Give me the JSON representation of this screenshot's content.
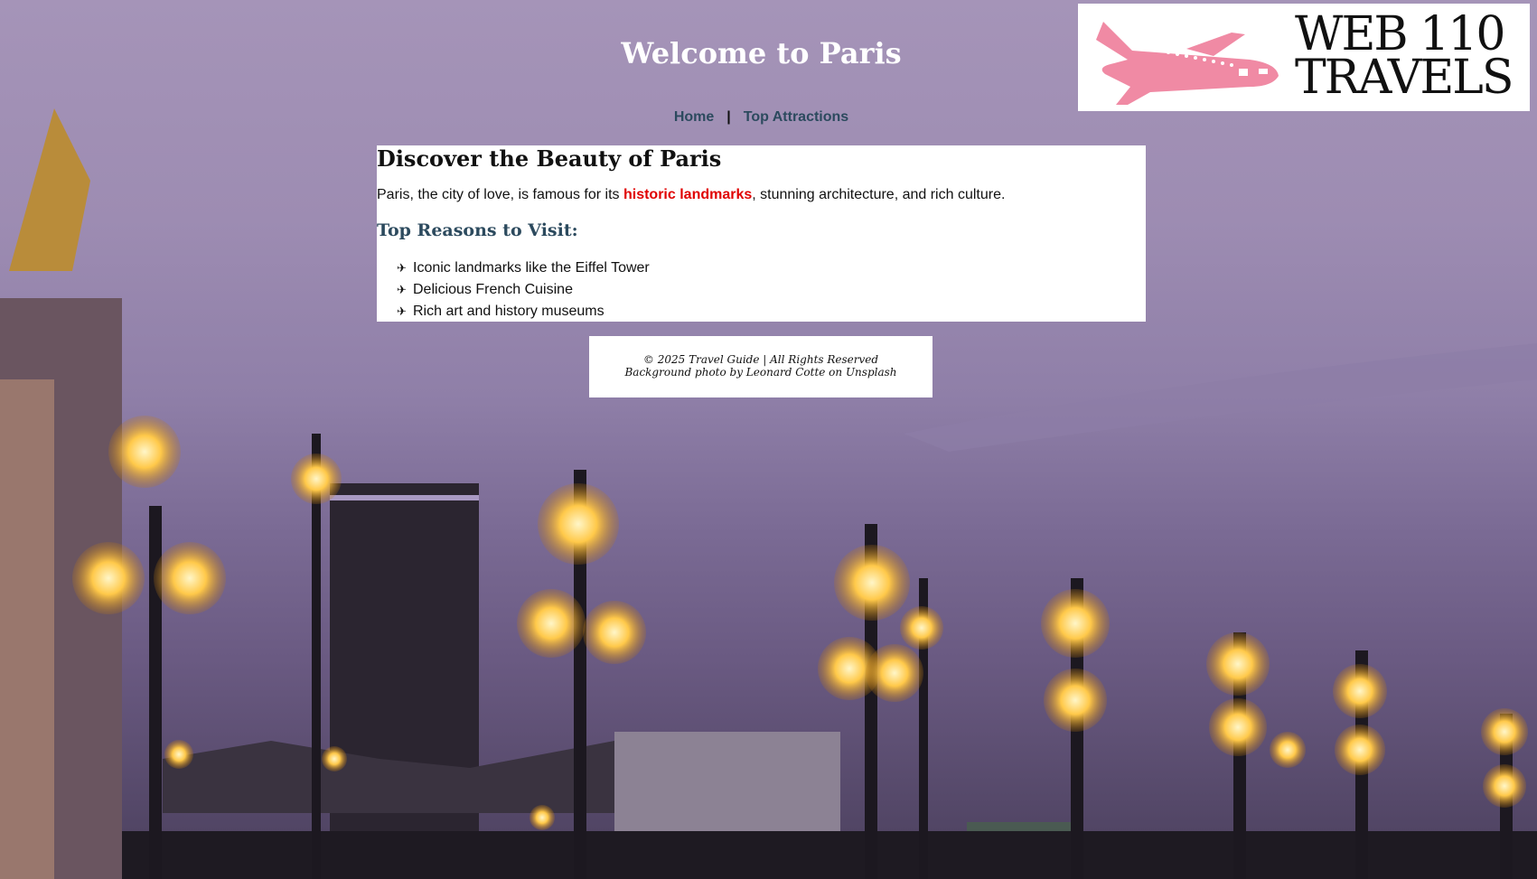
{
  "header": {
    "title": "Welcome to Paris",
    "logo": {
      "line1": "WEB 110",
      "line2": "TRAVELS",
      "icon": "airplane-icon",
      "icon_color": "#f08aa4"
    }
  },
  "nav": {
    "items": [
      {
        "label": "Home"
      },
      {
        "label": "Top Attractions"
      }
    ],
    "separator": "|"
  },
  "main": {
    "heading": "Discover the Beauty of Paris",
    "intro_before": "Paris, the city of love, is famous for its ",
    "intro_highlight": "historic landmarks",
    "intro_after": ", stunning architecture, and rich culture.",
    "subheading": "Top Reasons to Visit:",
    "reasons": [
      {
        "marker": "✈",
        "text": "Iconic landmarks like the Eiffel Tower"
      },
      {
        "marker": "✈",
        "text": "Delicious French Cuisine"
      },
      {
        "marker": "✈",
        "text": "Rich art and history museums"
      }
    ]
  },
  "footer": {
    "copyright": "© 2025 Travel Guide | All Rights Reserved",
    "credit": "Background photo by Leonard Cotte on Unsplash"
  },
  "colors": {
    "accent_text": "#2c4a5e",
    "highlight": "#e00000",
    "sky": "#a594b8"
  }
}
